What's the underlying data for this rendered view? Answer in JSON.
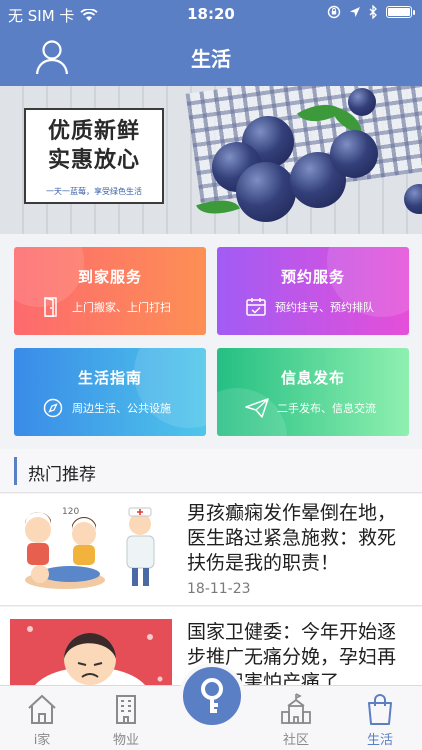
{
  "status_bar": {
    "carrier": "无 SIM 卡",
    "time": "18:20"
  },
  "nav": {
    "title": "生活"
  },
  "banner": {
    "line1": "优质新鲜",
    "line2": "实惠放心",
    "tagline": "一天一蓝莓，享受绿色生活"
  },
  "services": [
    {
      "title": "到家服务",
      "subtitle": "上门搬家、上门打扫",
      "icon": "door-icon"
    },
    {
      "title": "预约服务",
      "subtitle": "预约挂号、预约排队",
      "icon": "calendar-icon"
    },
    {
      "title": "生活指南",
      "subtitle": "周边生活、公共设施",
      "icon": "compass-icon"
    },
    {
      "title": "信息发布",
      "subtitle": "二手发布、信息交流",
      "icon": "paper-plane-icon"
    }
  ],
  "section": {
    "title": "热门推荐"
  },
  "news": [
    {
      "title": "男孩癫痫发作晕倒在地，医生路过紧急施救：救死扶伤是我的职责！",
      "date": "18-11-23"
    },
    {
      "title": "国家卫健委：今年开始逐步推广无痛分娩，孕妇再也不用害怕产痛了",
      "date": ""
    }
  ],
  "tabs": [
    {
      "label": "i家",
      "icon": "house-icon"
    },
    {
      "label": "物业",
      "icon": "building-icon"
    },
    {
      "label": "社区",
      "icon": "community-icon"
    },
    {
      "label": "生活",
      "icon": "shopping-bag-icon",
      "active": true
    }
  ],
  "colors": {
    "primary": "#5b7fc4",
    "page_background": "#f2f3f7"
  }
}
